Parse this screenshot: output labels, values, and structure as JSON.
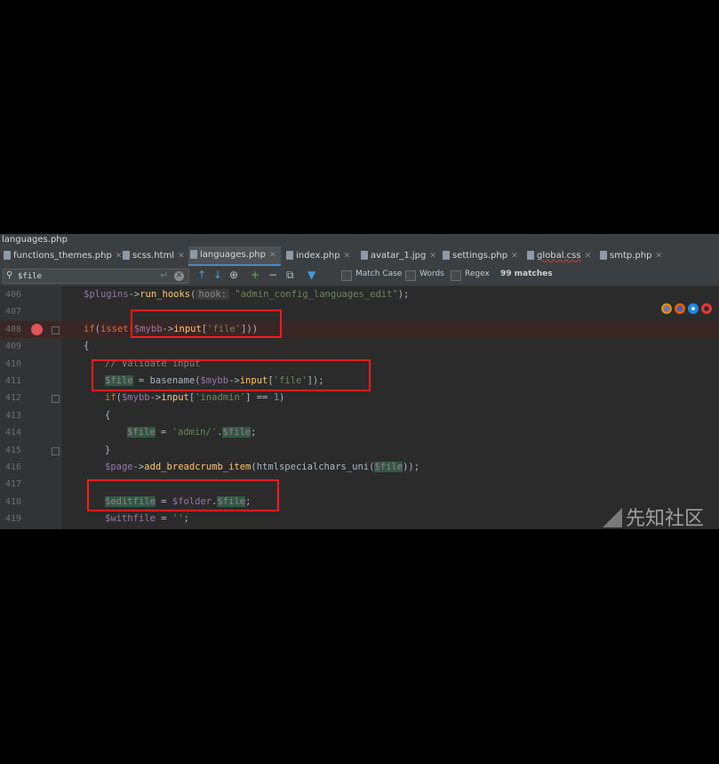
{
  "window_title": "languages.php",
  "tabs": [
    {
      "label": "functions_themes.php",
      "active": false
    },
    {
      "label": "scss.html",
      "active": false
    },
    {
      "label": "languages.php",
      "active": true
    },
    {
      "label": "index.php",
      "active": false
    },
    {
      "label": "avatar_1.jpg",
      "active": false
    },
    {
      "label": "settings.php",
      "active": false
    },
    {
      "label": "global.css",
      "active": false
    },
    {
      "label": "smtp.php",
      "active": false
    }
  ],
  "find": {
    "query": "$file",
    "match_case_label": "Match Case",
    "words_label": "Words",
    "regex_label": "Regex",
    "matches_text": "99 matches"
  },
  "code_lines": [
    {
      "num": "406"
    },
    {
      "num": "407"
    },
    {
      "num": "408"
    },
    {
      "num": "409"
    },
    {
      "num": "410"
    },
    {
      "num": "411"
    },
    {
      "num": "412"
    },
    {
      "num": "413"
    },
    {
      "num": "414"
    },
    {
      "num": "415"
    },
    {
      "num": "416"
    },
    {
      "num": "417"
    },
    {
      "num": "418"
    },
    {
      "num": "419"
    }
  ],
  "code": {
    "l406": {
      "a": "$plugins",
      "b": "->",
      "c": "run_hooks",
      "d": "(",
      "hint": "hook:",
      "e": "\"admin_config_languages_edit\"",
      "f": ");"
    },
    "l408": {
      "a": "if",
      "b": "(",
      "c": "isset",
      "d": "(",
      "e": "$mybb",
      "f": "->",
      "g": "input",
      "h": "[",
      "i": "'file'",
      "j": "]))"
    },
    "l409": {
      "a": "{"
    },
    "l410": {
      "a": "// Validate input"
    },
    "l411": {
      "a": "$file",
      "b": " = basename(",
      "c": "$mybb",
      "d": "->",
      "e": "input",
      "f": "[",
      "g": "'file'",
      "h": "]);"
    },
    "l412": {
      "a": "if",
      "b": "(",
      "c": "$mybb",
      "d": "->",
      "e": "input",
      "f": "[",
      "g": "'inadmin'",
      "h": "] == ",
      "i": "1",
      "j": ")"
    },
    "l413": {
      "a": "{"
    },
    "l414": {
      "a": "$file",
      "b": " = ",
      "c": "'admin/'",
      "d": ".",
      "e": "$file",
      "f": ";"
    },
    "l415": {
      "a": "}"
    },
    "l416": {
      "a": "$page",
      "b": "->",
      "c": "add_breadcrumb_item",
      "d": "(htmlspecialchars_uni(",
      "e": "$file",
      "f": "));"
    },
    "l418": {
      "a": "$editfile",
      "b": " = ",
      "c": "$folder",
      "d": ".",
      "e": "$file",
      "f": ";"
    },
    "l419": {
      "a": "$withfile",
      "b": " = ",
      "c": "''",
      "d": ";"
    }
  },
  "watermark": {
    "brand": "先知社区"
  },
  "colors": {
    "breakpoint": "#e05555",
    "annotation": "#ff1a1a",
    "editor_bg": "#2b2b2b"
  }
}
